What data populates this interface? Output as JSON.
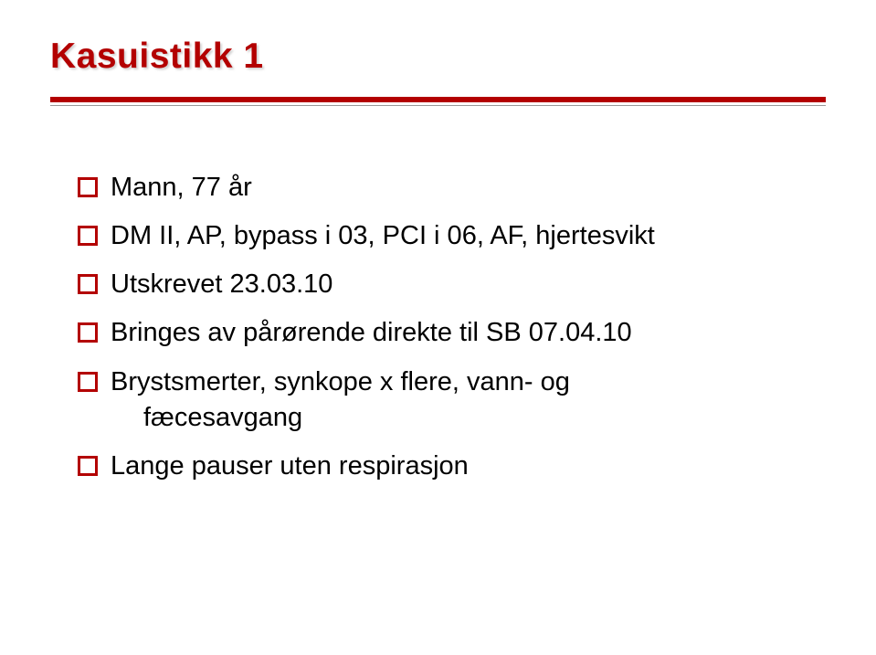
{
  "slide": {
    "title": "Kasuistikk 1",
    "bullets": [
      {
        "text": "Mann, 77 år"
      },
      {
        "text": "DM II,  AP, bypass i 03, PCI i 06,  AF, hjertesvikt"
      },
      {
        "text": "Utskrevet 23.03.10"
      },
      {
        "text": "Bringes av pårørende direkte til SB 07.04.10"
      },
      {
        "text": "Brystsmerter, synkope x flere, vann- og",
        "cont": "fæcesavgang"
      },
      {
        "text": "Lange pauser uten respirasjon"
      }
    ]
  },
  "colors": {
    "accent": "#b30000"
  }
}
